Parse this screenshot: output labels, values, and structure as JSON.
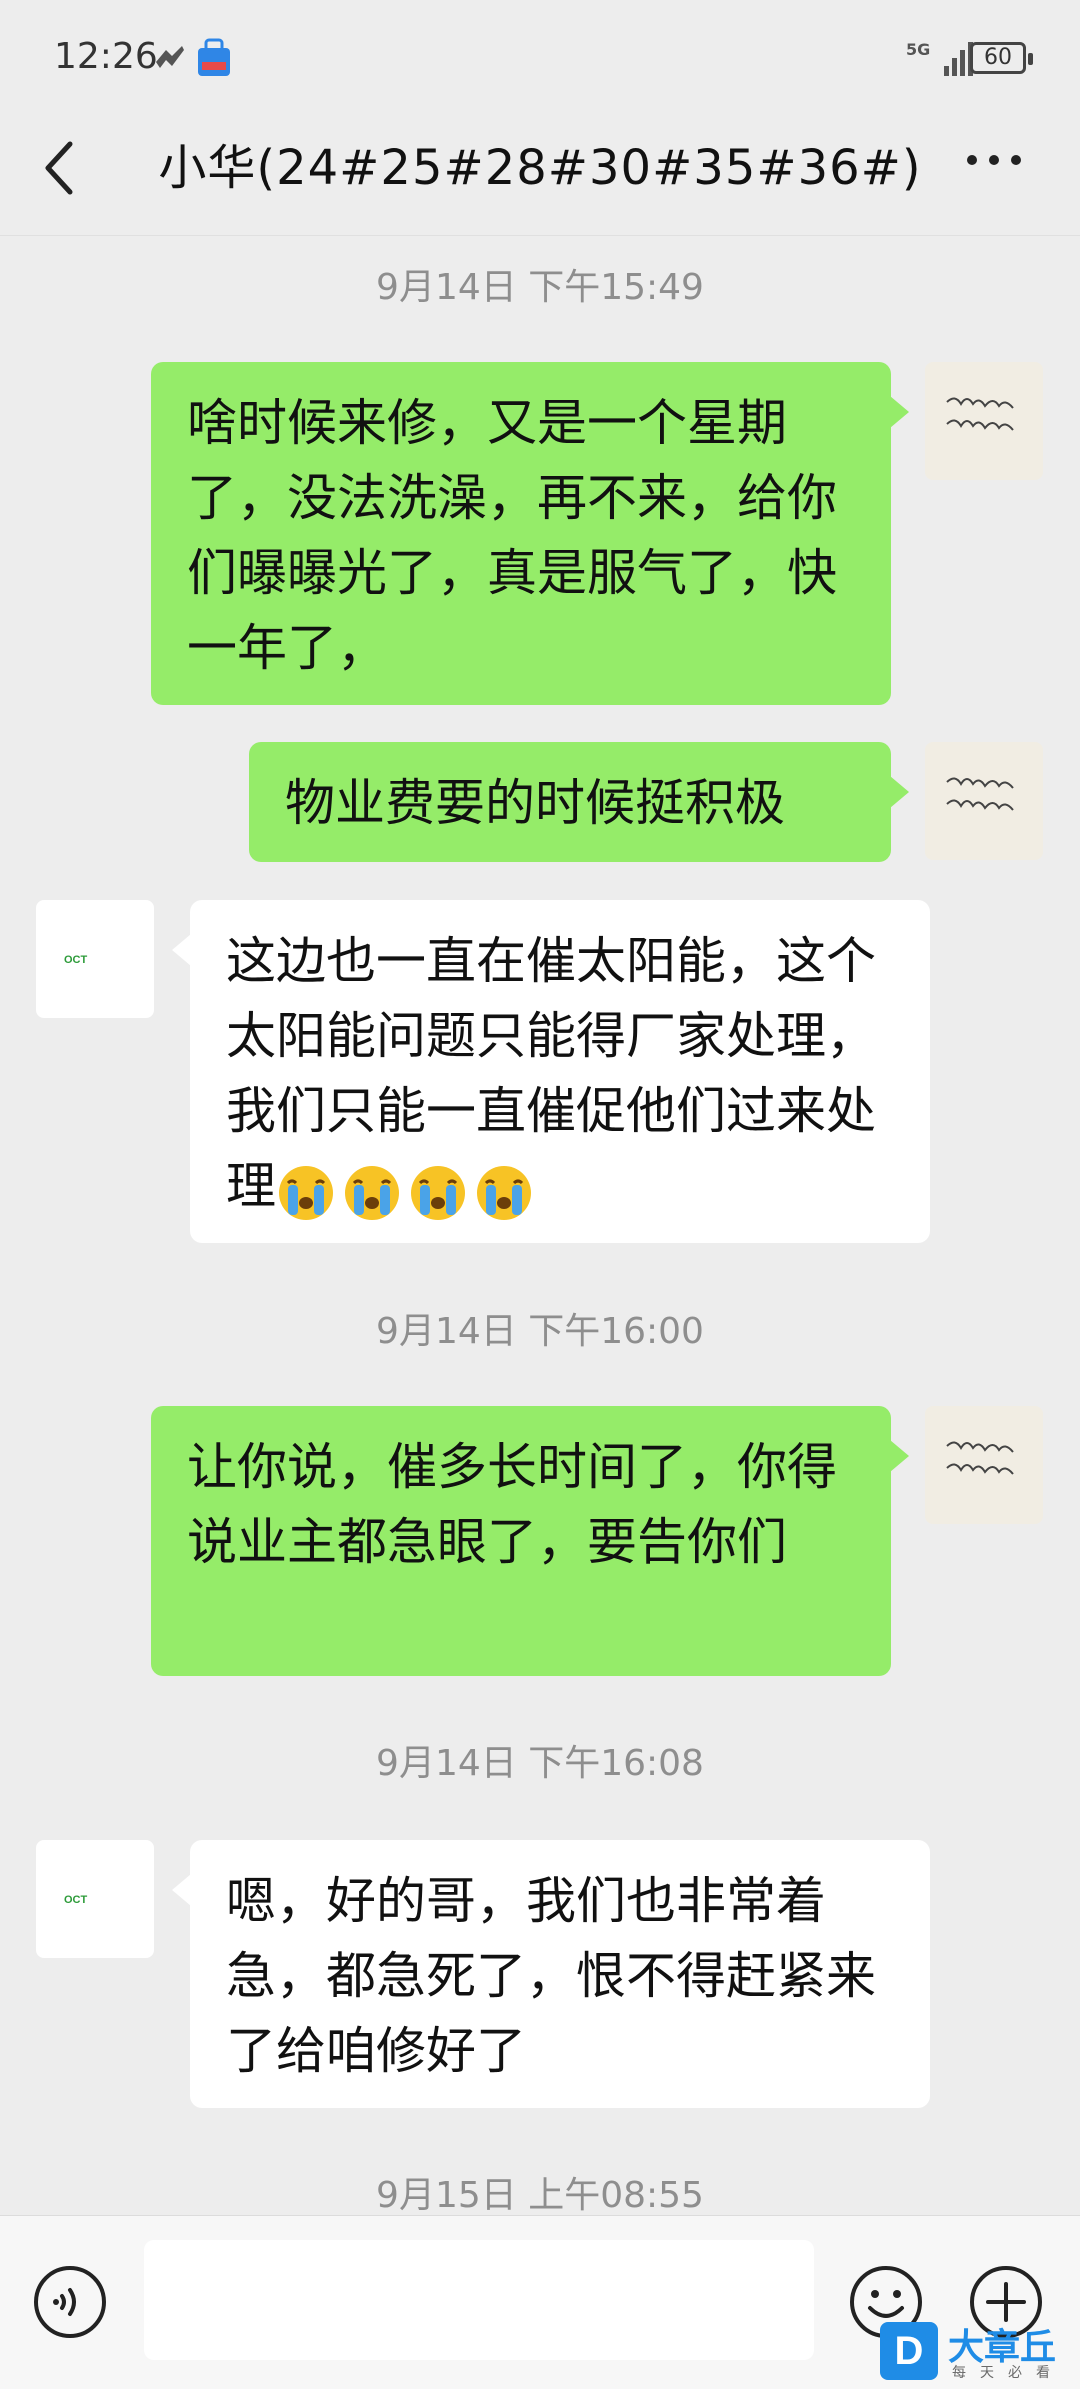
{
  "status_bar": {
    "time": "12:26",
    "network": "5G",
    "battery": "60"
  },
  "header": {
    "title": "小华(24#25#28#30#35#36#)"
  },
  "messages": [
    {
      "type": "timestamp",
      "text": "9月14日 下午15:49"
    },
    {
      "type": "sent",
      "text": "啥时候来修，又是一个星期了，没法洗澡，再不来，给你们曝曝光了，真是服气了，快一年了，"
    },
    {
      "type": "sent",
      "text": "物业费要的时候挺积极"
    },
    {
      "type": "received",
      "text": "这边也一直在催太阳能，这个太阳能问题只能得厂家处理，我们只能一直催促他们过来处理",
      "emoji_count": 4,
      "emoji": "loudly-crying-face"
    },
    {
      "type": "timestamp",
      "text": "9月14日 下午16:00"
    },
    {
      "type": "sent",
      "text": "让你说，催多长时间了，你得说业主都急眼了，要告你们"
    },
    {
      "type": "timestamp",
      "text": "9月14日 下午16:08"
    },
    {
      "type": "received",
      "text": "嗯，好的哥，我们也非常着急，都急死了，恨不得赶紧来了给咱修好了"
    },
    {
      "type": "timestamp",
      "text": "9月15日 上午08:55"
    }
  ],
  "avatars": {
    "contact_logo_text": "OCT"
  },
  "input_bar": {
    "placeholder": ""
  },
  "watermark": {
    "badge": "D",
    "name": "大章丘",
    "tagline": "每天必看"
  },
  "colors": {
    "sent_bubble": "#95ec69",
    "received_bubble": "#ffffff",
    "background": "#ededed"
  }
}
